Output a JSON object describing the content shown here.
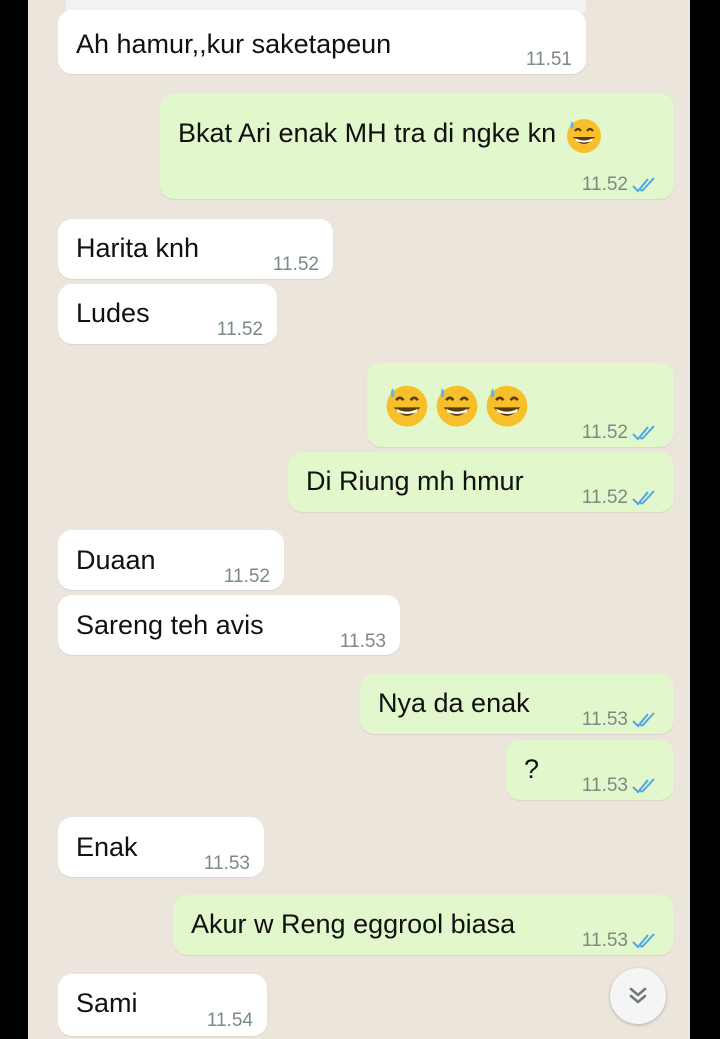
{
  "messages": [
    {
      "text": "Ah hamur,,kur saketapeun",
      "time": "11.51"
    },
    {
      "text": "Bkat Ari enak MH tra di ngke kn",
      "time": "11.52",
      "emoji": "grinning-sweat"
    },
    {
      "text": "Harita knh",
      "time": "11.52"
    },
    {
      "text": "Ludes",
      "time": "11.52"
    },
    {
      "text": "",
      "time": "11.52",
      "emoji_count": 3,
      "emoji": "grinning-sweat"
    },
    {
      "text": "Di Riung mh hmur",
      "time": "11.52"
    },
    {
      "text": "Duaan",
      "time": "11.52"
    },
    {
      "text": "Sareng teh avis",
      "time": "11.53"
    },
    {
      "text": "Nya da enak",
      "time": "11.53"
    },
    {
      "text": "?",
      "time": "11.53"
    },
    {
      "text": "Enak",
      "time": "11.53"
    },
    {
      "text": "Akur w Reng eggrool biasa",
      "time": "11.53"
    },
    {
      "text": "Sami",
      "time": "11.54"
    }
  ],
  "colors": {
    "background": "#ece5dc",
    "incoming": "#ffffff",
    "outgoing": "#e2f7cb",
    "read_ticks": "#4fa6e4"
  },
  "icons": {
    "read_receipt": "double-check-icon",
    "scroll_down": "double-chevron-down-icon",
    "emoji": "grinning-sweat-emoji-icon"
  }
}
